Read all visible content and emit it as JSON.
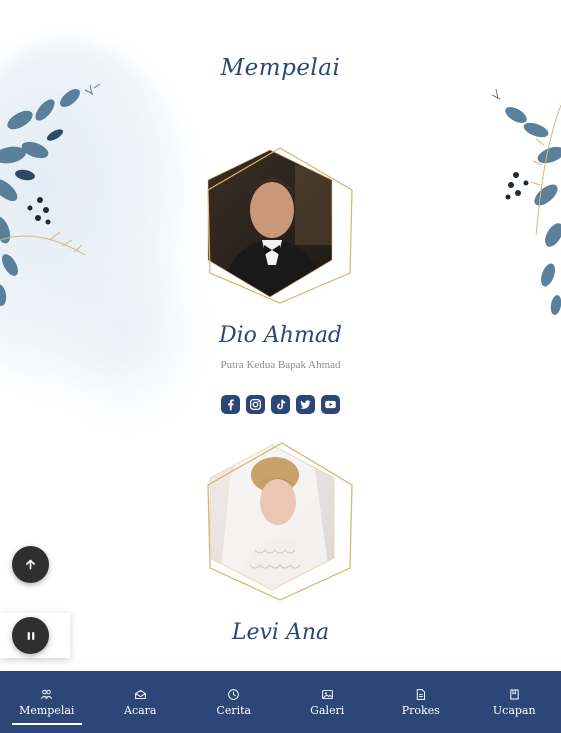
{
  "section": {
    "title": "Mempelai"
  },
  "groom": {
    "name": "Dio Ahmad",
    "subtitle": "Putra Kedua Bapak Ahmad",
    "socials": [
      "facebook-icon",
      "instagram-icon",
      "tiktok-icon",
      "twitter-icon",
      "youtube-icon"
    ]
  },
  "bride": {
    "name": "Levi Ana"
  },
  "nav": {
    "items": [
      {
        "label": "Mempelai",
        "icon": "couple-icon",
        "active": true
      },
      {
        "label": "Acara",
        "icon": "envelope-open-icon",
        "active": false
      },
      {
        "label": "Cerita",
        "icon": "clock-icon",
        "active": false
      },
      {
        "label": "Galeri",
        "icon": "image-icon",
        "active": false
      },
      {
        "label": "Prokes",
        "icon": "document-icon",
        "active": false
      },
      {
        "label": "Ucapan",
        "icon": "book-icon",
        "active": false
      }
    ]
  },
  "colors": {
    "primary": "#2c4777",
    "gold": "#d8b26a",
    "muted": "#8c8c8c",
    "fab": "#2f2f2f"
  }
}
